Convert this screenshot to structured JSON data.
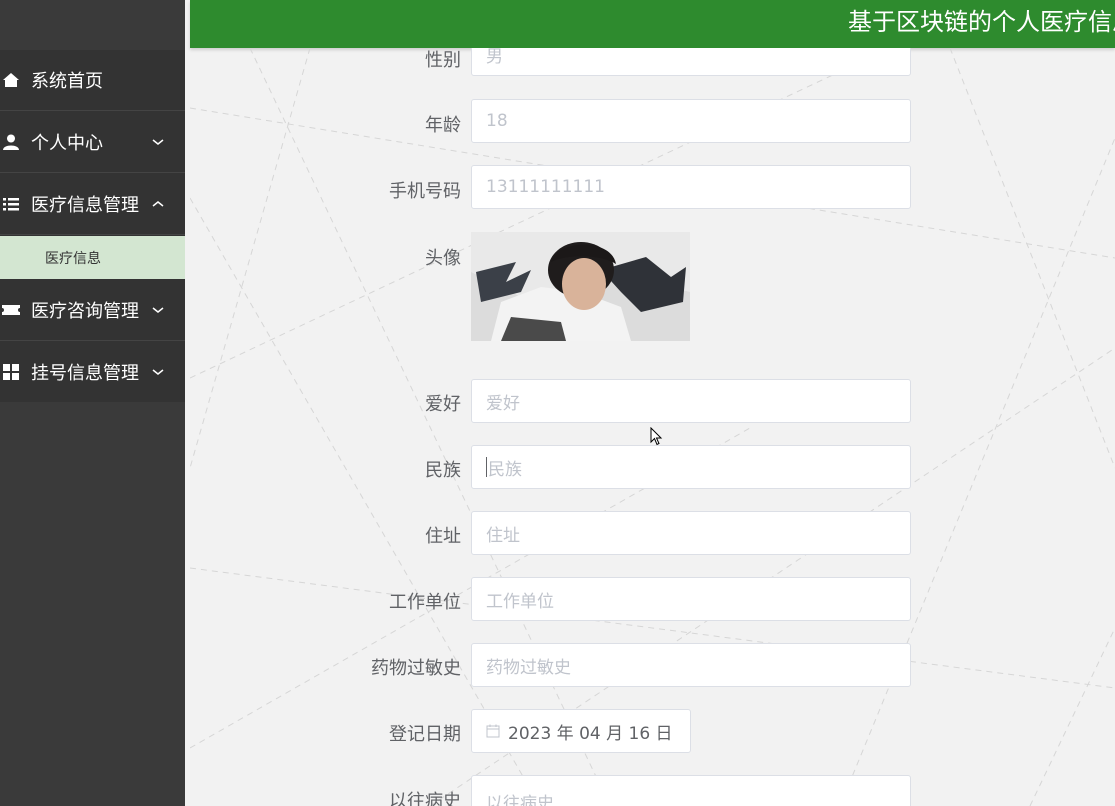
{
  "header": {
    "title": "基于区块链的个人医疗信息管理系统"
  },
  "sidebar": {
    "items": [
      {
        "label": "系统首页",
        "icon": "home-icon"
      },
      {
        "label": "个人中心",
        "icon": "user-icon",
        "chevron": "down"
      },
      {
        "label": "医疗信息管理",
        "icon": "list-icon",
        "chevron": "up"
      },
      {
        "label": "医疗咨询管理",
        "icon": "ticket-icon",
        "chevron": "down"
      },
      {
        "label": "挂号信息管理",
        "icon": "grid-icon",
        "chevron": "down"
      }
    ],
    "submenu": {
      "label": "医疗信息"
    }
  },
  "form": {
    "gender": {
      "label": "性别",
      "value": "男"
    },
    "age": {
      "label": "年龄",
      "value": "18"
    },
    "phone": {
      "label": "手机号码",
      "value": "13111111111"
    },
    "avatar": {
      "label": "头像"
    },
    "hobby": {
      "label": "爱好",
      "placeholder": "爱好"
    },
    "ethnicity": {
      "label": "民族",
      "placeholder": "民族"
    },
    "address": {
      "label": "住址",
      "placeholder": "住址"
    },
    "workplace": {
      "label": "工作单位",
      "placeholder": "工作单位"
    },
    "allergy": {
      "label": "药物过敏史",
      "placeholder": "药物过敏史"
    },
    "reg_date": {
      "label": "登记日期",
      "value": "2023 年 04 月 16 日"
    },
    "history": {
      "label": "以往病史",
      "placeholder": "以往病史"
    }
  },
  "colors": {
    "header_bg": "#2e8b2e",
    "sidebar_bg": "#333333",
    "submenu_active_bg": "#d3e6d1"
  }
}
